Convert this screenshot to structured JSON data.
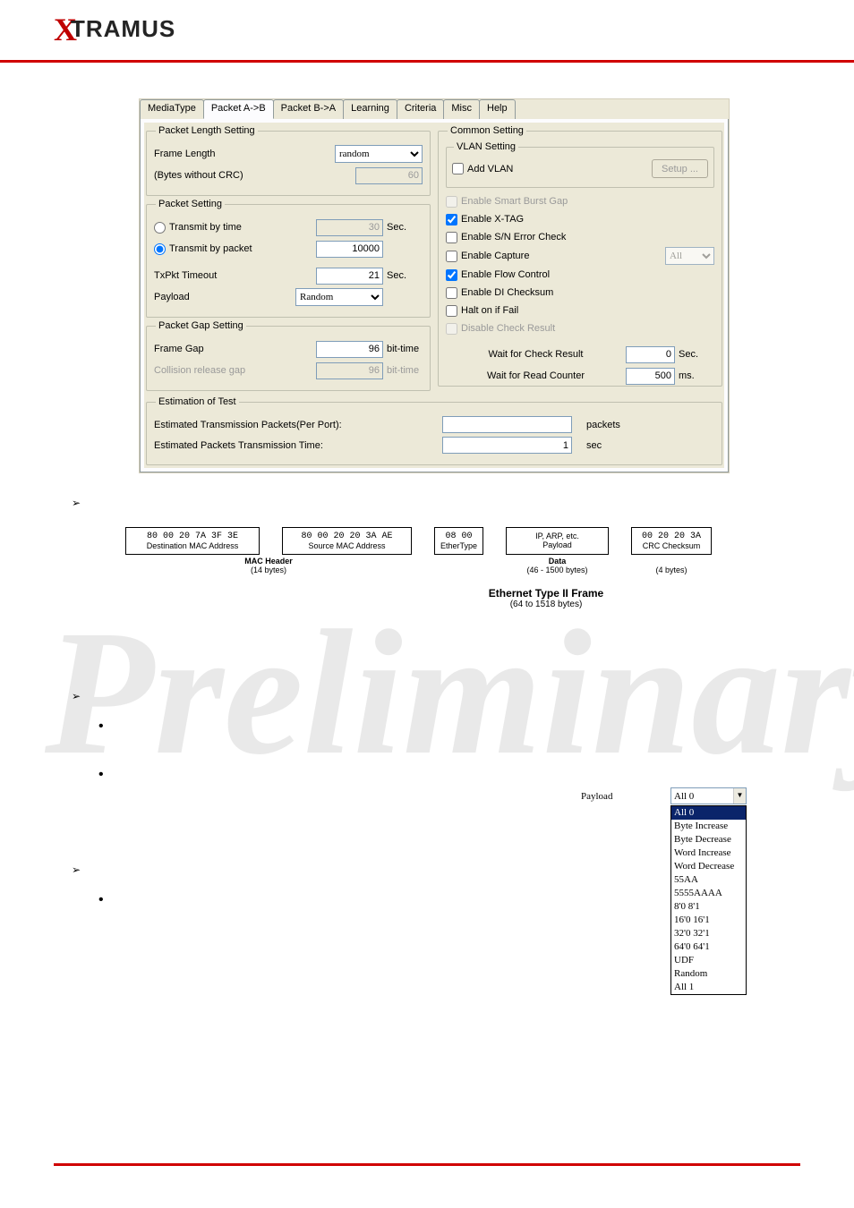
{
  "logo": {
    "x": "X",
    "rest": "TRAMUS"
  },
  "tabs": {
    "items": [
      "MediaType",
      "Packet A->B",
      "Packet B->A",
      "Learning",
      "Criteria",
      "Misc",
      "Help"
    ],
    "active_index": 1
  },
  "packet_length": {
    "legend": "Packet Length Setting",
    "frame_length_label": "Frame Length",
    "frame_length_value": "random",
    "bytes_label": "(Bytes without CRC)",
    "bytes_value": "60"
  },
  "packet_setting": {
    "legend": "Packet Setting",
    "transmit_time_label": "Transmit by time",
    "transmit_time_value": "30",
    "transmit_time_unit": "Sec.",
    "transmit_packet_label": "Transmit by packet",
    "transmit_packet_value": "10000",
    "txpkt_timeout_label": "TxPkt Timeout",
    "txpkt_timeout_value": "21",
    "txpkt_timeout_unit": "Sec.",
    "payload_label": "Payload",
    "payload_value": "Random"
  },
  "packet_gap": {
    "legend": "Packet Gap Setting",
    "frame_gap_label": "Frame Gap",
    "frame_gap_value": "96",
    "frame_gap_unit": "bit-time",
    "collision_label": "Collision release gap",
    "collision_value": "96",
    "collision_unit": "bit-time"
  },
  "common": {
    "legend": "Common Setting",
    "vlan": {
      "legend": "VLAN Setting",
      "add_vlan_label": "Add VLAN",
      "setup_btn": "Setup ..."
    },
    "checks": {
      "smart_burst": "Enable Smart Burst Gap",
      "xtag": "Enable X-TAG",
      "sn_error": "Enable S/N Error Check",
      "capture": "Enable Capture",
      "capture_sel": "All",
      "flow_control": "Enable Flow Control",
      "di_checksum": "Enable DI Checksum",
      "halt_fail": "Halt on if Fail",
      "disable_check": "Disable Check Result"
    },
    "wait_check_label": "Wait for Check Result",
    "wait_check_value": "0",
    "wait_check_unit": "Sec.",
    "wait_read_label": "Wait for Read Counter",
    "wait_read_value": "500",
    "wait_read_unit": "ms."
  },
  "estimation": {
    "legend": "Estimation of Test",
    "packets_label": "Estimated Transmission Packets(Per Port):",
    "packets_value": "",
    "packets_unit": "packets",
    "time_label": "Estimated Packets Transmission Time:",
    "time_value": "1",
    "time_unit": "sec"
  },
  "diagram": {
    "dest_hex": "80 00 20 7A 3F 3E",
    "dest_label": "Destination MAC Address",
    "src_hex": "80 00 20 20 3A AE",
    "src_label": "Source MAC Address",
    "eth_hex": "08 00",
    "eth_label": "EtherType",
    "payload_top": "IP, ARP, etc.",
    "payload_label": "Payload",
    "crc_hex": "00 20 20 3A",
    "crc_label": "CRC Checksum",
    "mac_header": "MAC Header",
    "mac_bytes": "(14 bytes)",
    "data_label": "Data",
    "data_bytes": "(46 - 1500 bytes)",
    "crc_bytes": "(4 bytes)",
    "title": "Ethernet Type II Frame",
    "subtitle": "(64 to 1518 bytes)"
  },
  "payload_combo": {
    "label": "Payload",
    "selected": "All 0",
    "options": [
      "All 0",
      "Byte Increase",
      "Byte Decrease",
      "Word Increase",
      "Word Decrease",
      "55AA",
      "5555AAAA",
      "8'0 8'1",
      "16'0 16'1",
      "32'0 32'1",
      "64'0 64'1",
      "UDF",
      "Random",
      "All 1"
    ]
  },
  "watermark": "Preliminary"
}
